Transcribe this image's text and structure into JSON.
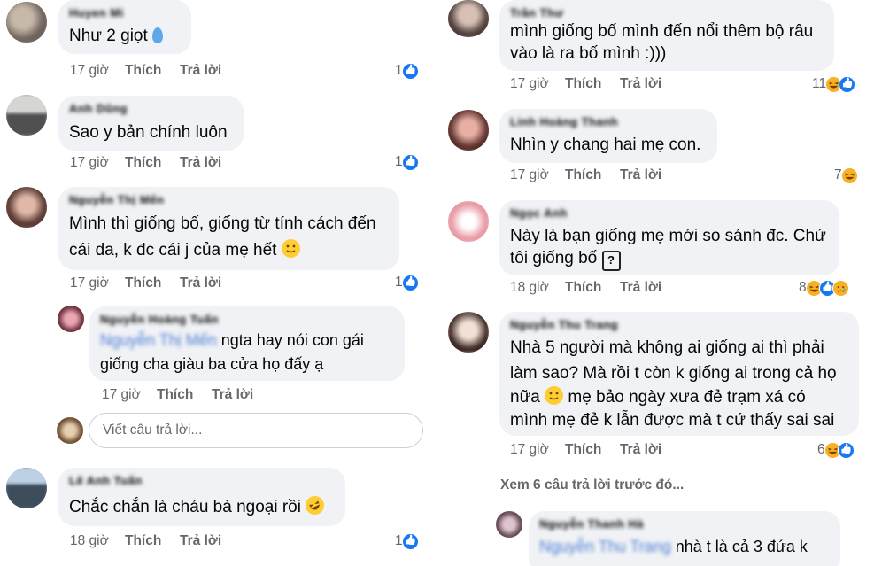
{
  "left": {
    "comments": [
      {
        "author": "Huyen Mi",
        "text_lines": [
          "Như 2 giọt"
        ],
        "time": "17 giờ",
        "like_label": "Thích",
        "reply_label": "Trả lời",
        "react_count": "1",
        "reactions": [
          "like-icon"
        ]
      },
      {
        "author": "Anh Dũng",
        "text_lines": [
          "Sao y bản chính luôn"
        ],
        "time": "17 giờ",
        "like_label": "Thích",
        "reply_label": "Trả lời",
        "react_count": "1",
        "reactions": [
          "like-icon"
        ]
      },
      {
        "author": "Nguyễn Thị Mến",
        "text_lines": [
          "Mình thì giống bố, giống từ tính cách đến",
          "cái da, k đc cái j của mẹ hết"
        ],
        "time": "17 giờ",
        "like_label": "Thích",
        "reply_label": "Trả lời",
        "react_count": "1",
        "reactions": [
          "like-icon"
        ]
      },
      {
        "author": "Lê Anh Tuấn",
        "text_lines": [
          "Chắc chắn là cháu bà ngoại rồi"
        ],
        "time": "18 giờ",
        "like_label": "Thích",
        "reply_label": "Trả lời",
        "react_count": "1",
        "reactions": [
          "like-icon"
        ]
      }
    ],
    "reply": {
      "author": "Nguyễn Hoàng Tuấn",
      "mention": "Nguyễn Thị Mến",
      "text_line1_rest": " ngta hay nói con gái",
      "text_line2": "giống cha giàu ba cửa họ đấy ạ",
      "time": "17 giờ",
      "like_label": "Thích",
      "reply_label": "Trả lời"
    },
    "reply_input": {
      "placeholder": "Viết câu trả lời..."
    }
  },
  "right": {
    "comments": [
      {
        "author": "Trần Thư",
        "text_lines": [
          "mình giống bố mình đến nổi thêm bộ râu",
          "vào là ra bố mình :)))"
        ],
        "time": "17 giờ",
        "like_label": "Thích",
        "reply_label": "Trả lời",
        "react_count": "11",
        "reactions": [
          "haha-icon",
          "like-icon"
        ]
      },
      {
        "author": "Linh Hoàng Thanh",
        "text_lines": [
          "Nhìn y chang hai mẹ con."
        ],
        "time": "17 giờ",
        "like_label": "Thích",
        "reply_label": "Trả lời",
        "react_count": "7",
        "reactions": [
          "haha-icon"
        ]
      },
      {
        "author": "Ngọc Anh",
        "text_lines": [
          "Này là bạn giống mẹ mới so sánh đc. Chứ",
          "tôi giống bố"
        ],
        "time": "18 giờ",
        "like_label": "Thích",
        "reply_label": "Trả lời",
        "react_count": "8",
        "reactions": [
          "haha-icon",
          "like-icon",
          "sad-icon"
        ]
      },
      {
        "author": "Nguyễn Thu Trang",
        "text_lines": [
          "Nhà 5 người mà không ai giống ai thì phải",
          "làm sao? Mà rồi t còn k giống ai trong cả họ",
          "nữa",
          " mẹ bảo ngày xưa đẻ trạm xá có",
          "mình mẹ đẻ k lẫn được mà t cứ thấy sai sai"
        ],
        "time": "17 giờ",
        "like_label": "Thích",
        "reply_label": "Trả lời",
        "react_count": "6",
        "reactions": [
          "haha-icon",
          "like-icon"
        ]
      }
    ],
    "view_more": "Xem 6 câu trả lời trước đó...",
    "partial_reply": {
      "author": "Nguyễn Thanh Hà",
      "mention": "Nguyễn Thu Trang",
      "text_rest": " nhà t là cả 3 đứa k"
    }
  },
  "colors": {
    "bubble": "#f0f2f5",
    "meta": "#65676b",
    "like_blue": "#1877f2",
    "haha_yellow": "#f7b125",
    "mention": "#4f7fd6"
  }
}
